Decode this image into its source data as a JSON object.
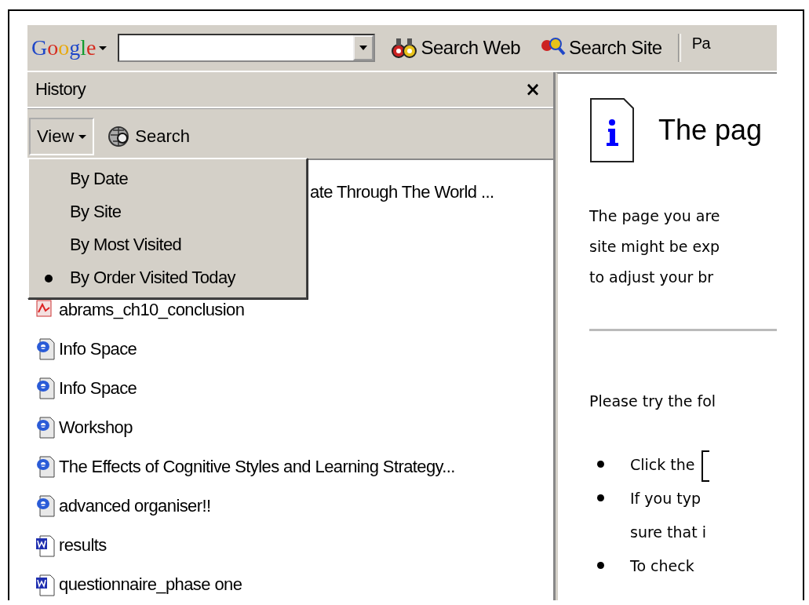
{
  "toolbar": {
    "logo": "Google",
    "buttons": [
      {
        "label": "Search Web",
        "kind": "web"
      },
      {
        "label": "Search Site",
        "kind": "site"
      },
      {
        "label": "Pa",
        "kind": "cut"
      }
    ]
  },
  "history": {
    "title": "History",
    "close": "×",
    "view_button": "View",
    "search_button": "Search",
    "items": [
      {
        "label": "ate Through The World ...",
        "kind": "partial"
      },
      {
        "label": "abrams_ch10_conclusion",
        "kind": "pdf"
      },
      {
        "label": "Info Space",
        "kind": "web"
      },
      {
        "label": "Info Space",
        "kind": "web"
      },
      {
        "label": "Workshop",
        "kind": "web"
      },
      {
        "label": "The Effects of Cognitive Styles and Learning Strategy...",
        "kind": "web"
      },
      {
        "label": "advanced organiser!!",
        "kind": "web"
      },
      {
        "label": "results",
        "kind": "word"
      },
      {
        "label": "questionnaire_phase one",
        "kind": "word"
      }
    ],
    "view_menu": [
      {
        "label": "By Date",
        "selected": false
      },
      {
        "label": "By Site",
        "selected": false
      },
      {
        "label": "By Most Visited",
        "selected": false
      },
      {
        "label": "By Order Visited Today",
        "selected": true
      }
    ]
  },
  "page": {
    "heading": "The pag",
    "paragraph": [
      "The page you are",
      "site might be exp",
      "to adjust your br"
    ],
    "try": "Please try the fol",
    "bullets": [
      [
        "Click the"
      ],
      [
        "If you typ",
        "sure that i"
      ],
      [
        "To check"
      ]
    ]
  }
}
